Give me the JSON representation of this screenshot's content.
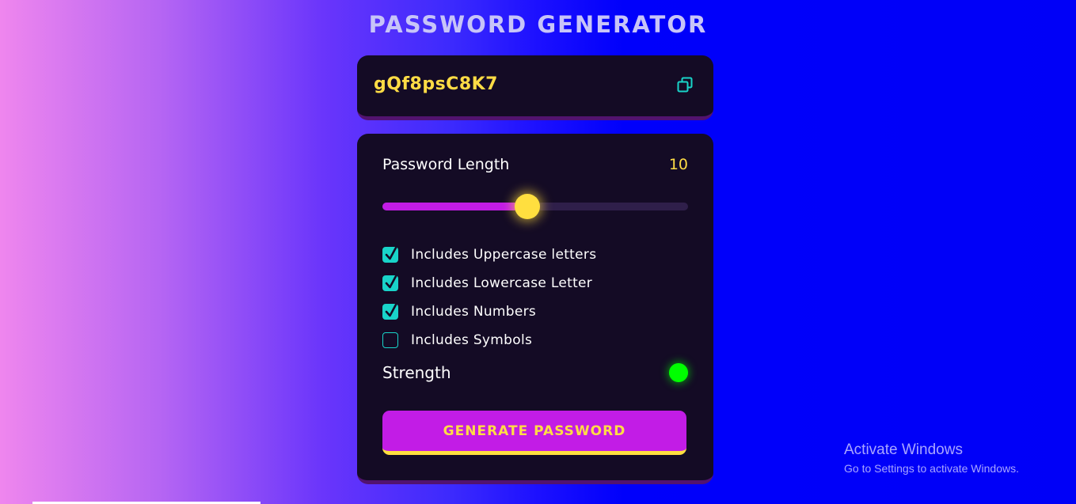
{
  "app": {
    "title": "PASSWORD GENERATOR"
  },
  "display": {
    "password": "gQf8psC8K7",
    "copy_icon": "copy-icon"
  },
  "settings": {
    "length_label": "Password Length",
    "length_value": "10",
    "slider": {
      "value": 10,
      "fraction": 0.475
    },
    "options": [
      {
        "label": "Includes Uppercase letters",
        "checked": true
      },
      {
        "label": "Includes Lowercase Letter",
        "checked": true
      },
      {
        "label": "Includes Numbers",
        "checked": true
      },
      {
        "label": "Includes Symbols",
        "checked": false
      }
    ],
    "strength_label": "Strength",
    "strength_color": "#00ff00",
    "generate_label": "GENERATE PASSWORD"
  },
  "watermark": {
    "title": "Activate Windows",
    "subtitle": "Go to Settings to activate Windows."
  },
  "colors": {
    "accent": "#c21ce6",
    "highlight": "#ffdc45",
    "checkbox": "#19d4c9",
    "card": "#140b25"
  }
}
